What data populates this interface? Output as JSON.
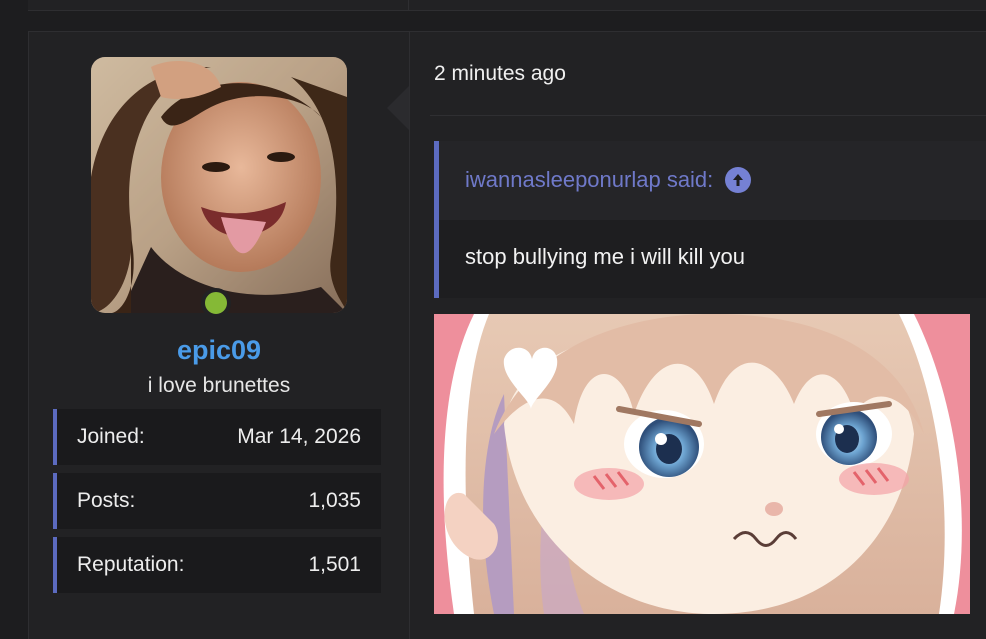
{
  "post": {
    "timestamp": "2 minutes ago"
  },
  "user": {
    "username": "epic09",
    "title": "i love brunettes",
    "online": true
  },
  "stats": [
    {
      "label": "Joined:",
      "value": "Mar 14, 2026"
    },
    {
      "label": "Posts:",
      "value": "1,035"
    },
    {
      "label": "Reputation:",
      "value": "1,501"
    }
  ],
  "quote": {
    "author": "iwannasleeponurlap said:",
    "text": "stop bullying me i will kill you",
    "icon": "arrow-up-circle-icon"
  },
  "colors": {
    "accent": "#5c6bc0",
    "username": "#4a9be8",
    "online": "#85b936"
  }
}
